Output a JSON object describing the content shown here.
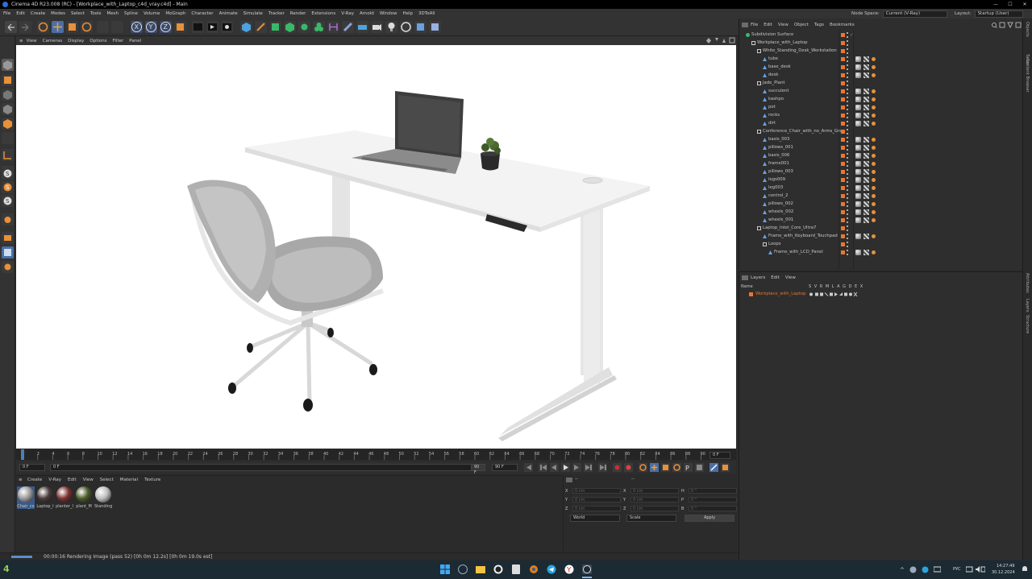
{
  "window": {
    "title": "Cinema 4D R23.008 (RC) - [Workplace_with_Laptop_c4d_vray.c4d] - Main",
    "controls": [
      "—",
      "☐",
      "✕"
    ]
  },
  "menubar": {
    "items": [
      "File",
      "Edit",
      "Create",
      "Modes",
      "Select",
      "Tools",
      "Mesh",
      "Spline",
      "Volume",
      "MoGraph",
      "Character",
      "Animate",
      "Simulate",
      "Tracker",
      "Render",
      "Extensions",
      "V-Ray",
      "Arnold",
      "Window",
      "Help",
      "3DToAll"
    ],
    "node_space_label": "Node Space:",
    "node_space_value": "Current (V-Ray)",
    "layout_label": "Layout:",
    "layout_value": "Startup (User)"
  },
  "viewport": {
    "menu": [
      "View",
      "Cameras",
      "Display",
      "Options",
      "Filter",
      "Panel"
    ]
  },
  "timeline": {
    "ticks": [
      "0",
      "2",
      "4",
      "6",
      "8",
      "10",
      "12",
      "14",
      "16",
      "18",
      "20",
      "22",
      "24",
      "26",
      "28",
      "30",
      "32",
      "34",
      "36",
      "38",
      "40",
      "42",
      "44",
      "46",
      "48",
      "50",
      "52",
      "54",
      "56",
      "58",
      "60",
      "62",
      "64",
      "66",
      "68",
      "70",
      "72",
      "74",
      "76",
      "78",
      "80",
      "82",
      "84",
      "86",
      "88",
      "90"
    ],
    "current_frame": "0 F",
    "start_frame": "0 F",
    "range_start": "0 F",
    "range_end": "90 F",
    "end_frame": "90 F",
    "frame_field_right": "0 F"
  },
  "materials": {
    "menu": [
      "Create",
      "V-Ray",
      "Edit",
      "View",
      "Select",
      "Material",
      "Texture"
    ],
    "items": [
      {
        "label": "Chair_co",
        "color": "#9a9a9a"
      },
      {
        "label": "Laptop_I",
        "color": "#4a3a3a"
      },
      {
        "label": "planter_l",
        "color": "#7a3030"
      },
      {
        "label": "plant_M",
        "color": "#4a5a2a"
      },
      {
        "label": "Standing",
        "color": "#bdbdbd"
      }
    ]
  },
  "coordinates": {
    "header_left": "--",
    "header_right": "--",
    "rows": [
      {
        "a": "X",
        "av": "0 cm",
        "b": "X",
        "bv": "0 cm",
        "c": "H",
        "cv": "0 °"
      },
      {
        "a": "Y",
        "av": "0 cm",
        "b": "Y",
        "bv": "0 cm",
        "c": "P",
        "cv": "0 °"
      },
      {
        "a": "Z",
        "av": "0 cm",
        "b": "Z",
        "bv": "0 cm",
        "c": "B",
        "cv": "0 °"
      }
    ],
    "mode_left": "World",
    "mode_right": "Scale",
    "apply": "Apply"
  },
  "status": {
    "text": "00:00:16 Rendering Image (pass 52) [0h  0m 12.2s] [0h  0m 19.0s est]"
  },
  "objects": {
    "menu": [
      "File",
      "Edit",
      "View",
      "Object",
      "Tags",
      "Bookmarks"
    ],
    "tree": [
      {
        "name": "Subdivision Surface",
        "level": 0,
        "type": "sds"
      },
      {
        "name": "Workplace_with_Laptop",
        "level": 1,
        "type": "null"
      },
      {
        "name": "White_Standing_Desk_Workstation",
        "level": 2,
        "type": "null"
      },
      {
        "name": "tube",
        "level": 3,
        "type": "poly"
      },
      {
        "name": "base_desk",
        "level": 3,
        "type": "poly"
      },
      {
        "name": "desk",
        "level": 3,
        "type": "poly"
      },
      {
        "name": "Jade_Plant",
        "level": 2,
        "type": "null"
      },
      {
        "name": "succulent",
        "level": 3,
        "type": "poly"
      },
      {
        "name": "kashpo",
        "level": 3,
        "type": "poly"
      },
      {
        "name": "pot",
        "level": 3,
        "type": "poly"
      },
      {
        "name": "rocks",
        "level": 3,
        "type": "poly"
      },
      {
        "name": "dirt",
        "level": 3,
        "type": "poly"
      },
      {
        "name": "Conference_Chair_with_no_Arms_Grey",
        "level": 2,
        "type": "null"
      },
      {
        "name": "basis_003",
        "level": 3,
        "type": "poly"
      },
      {
        "name": "pillows_001",
        "level": 3,
        "type": "poly"
      },
      {
        "name": "basis_006",
        "level": 3,
        "type": "poly"
      },
      {
        "name": "frame001",
        "level": 3,
        "type": "poly"
      },
      {
        "name": "pillows_003",
        "level": 3,
        "type": "poly"
      },
      {
        "name": "legs009",
        "level": 3,
        "type": "poly"
      },
      {
        "name": "leg003",
        "level": 3,
        "type": "poly"
      },
      {
        "name": "control_2",
        "level": 3,
        "type": "poly"
      },
      {
        "name": "pillows_002",
        "level": 3,
        "type": "poly"
      },
      {
        "name": "wheels_002",
        "level": 3,
        "type": "poly"
      },
      {
        "name": "wheels_001",
        "level": 3,
        "type": "poly"
      },
      {
        "name": "Laptop_Intel_Core_Ultra7",
        "level": 2,
        "type": "null"
      },
      {
        "name": "Frame_with_Keyboard_Touchpad",
        "level": 3,
        "type": "poly"
      },
      {
        "name": "Loops",
        "level": 3,
        "type": "null"
      },
      {
        "name": "Frame_with_LCD_Panel",
        "level": 4,
        "type": "poly"
      }
    ]
  },
  "layers": {
    "menu": [
      "Layers",
      "Edit",
      "View"
    ],
    "header_name": "Name",
    "header_cols": "S V R M L A G D E X",
    "items": [
      {
        "name": "Workplace_with_Laptop",
        "color": "#e8772e"
      }
    ]
  },
  "right_strip": [
    "Objects",
    "Takes",
    "Content Browser",
    "Attributes",
    "Layers",
    "Structure"
  ],
  "taskbar": {
    "lang": "РУС",
    "time": "14:27:49",
    "date": "30.12.2024"
  }
}
